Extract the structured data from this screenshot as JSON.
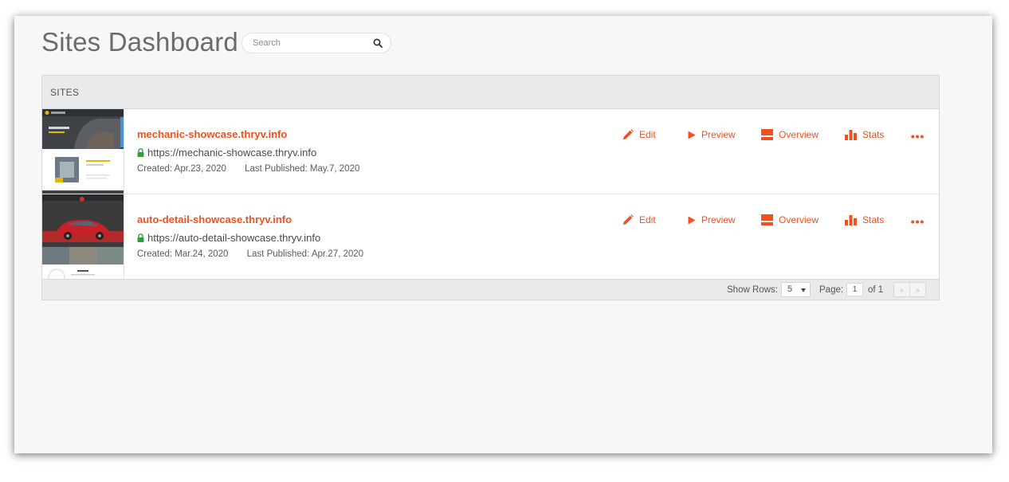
{
  "page": {
    "title": "Sites Dashboard"
  },
  "search": {
    "placeholder": "Search",
    "value": ""
  },
  "panel": {
    "header": "SITES"
  },
  "actions": {
    "edit": "Edit",
    "preview": "Preview",
    "overview": "Overview",
    "stats": "Stats"
  },
  "sites": [
    {
      "name": "mechanic-showcase.thryv.info",
      "url": "https://mechanic-showcase.thryv.info",
      "created": "Created: Apr.23, 2020",
      "published": "Last Published: May.7, 2020",
      "thumb_icon": "mechanic-site-thumbnail"
    },
    {
      "name": "auto-detail-showcase.thryv.info",
      "url": "https://auto-detail-showcase.thryv.info",
      "created": "Created: Mar.24, 2020",
      "published": "Last Published: Apr.27, 2020",
      "thumb_icon": "auto-detail-site-thumbnail"
    }
  ],
  "footer": {
    "show_rows_label": "Show Rows:",
    "rows_value": "5",
    "page_label": "Page:",
    "page_value": "1",
    "page_of": "of 1",
    "prev_glyph": "«",
    "next_glyph": "»"
  },
  "colors": {
    "accent": "#f4501e",
    "secure_lock": "#2e9e3e",
    "panel_header_bg": "#e8eaeb",
    "page_bg": "#f7f7f7"
  }
}
